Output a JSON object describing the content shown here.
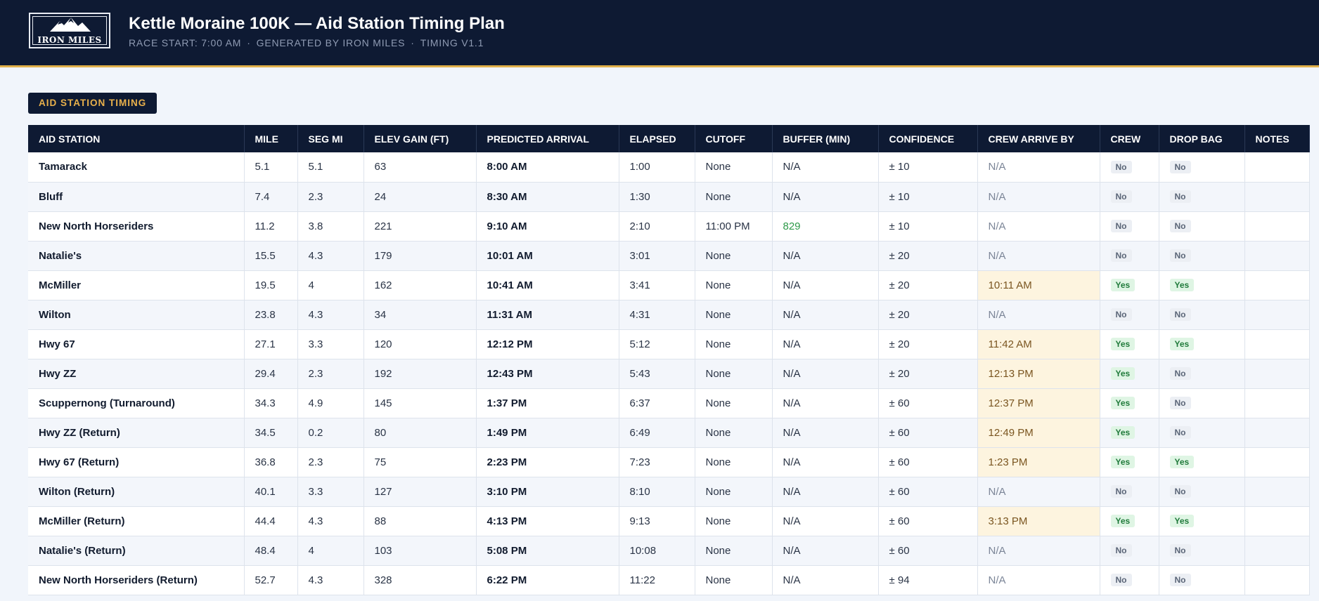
{
  "header": {
    "logo_text": "IRON MILES",
    "title": "Kettle Moraine 100K — Aid Station Timing Plan",
    "subtitle_parts": [
      "RACE START: 7:00 AM",
      "GENERATED BY IRON MILES",
      "TIMING V1.1"
    ],
    "colors": {
      "background": "#0e1a33",
      "accent": "#e0b04a"
    }
  },
  "section_tag": "AID STATION TIMING",
  "table": {
    "columns": [
      "AID STATION",
      "MILE",
      "SEG MI",
      "ELEV GAIN (FT)",
      "PREDICTED ARRIVAL",
      "ELAPSED",
      "CUTOFF",
      "BUFFER (MIN)",
      "CONFIDENCE",
      "CREW ARRIVE BY",
      "CREW",
      "DROP BAG",
      "NOTES"
    ],
    "rows": [
      {
        "station": "Tamarack",
        "mile": "5.1",
        "seg": "5.1",
        "elev": "63",
        "arrival": "8:00 AM",
        "elapsed": "1:00",
        "cutoff": "None",
        "buffer": "N/A",
        "confidence": "± 10",
        "crew_by": "N/A",
        "crew": "No",
        "drop_bag": "No",
        "notes": ""
      },
      {
        "station": "Bluff",
        "mile": "7.4",
        "seg": "2.3",
        "elev": "24",
        "arrival": "8:30 AM",
        "elapsed": "1:30",
        "cutoff": "None",
        "buffer": "N/A",
        "confidence": "± 10",
        "crew_by": "N/A",
        "crew": "No",
        "drop_bag": "No",
        "notes": ""
      },
      {
        "station": "New North Horseriders",
        "mile": "11.2",
        "seg": "3.8",
        "elev": "221",
        "arrival": "9:10 AM",
        "elapsed": "2:10",
        "cutoff": "11:00 PM",
        "buffer": "829",
        "confidence": "± 10",
        "crew_by": "N/A",
        "crew": "No",
        "drop_bag": "No",
        "notes": ""
      },
      {
        "station": "Natalie's",
        "mile": "15.5",
        "seg": "4.3",
        "elev": "179",
        "arrival": "10:01 AM",
        "elapsed": "3:01",
        "cutoff": "None",
        "buffer": "N/A",
        "confidence": "± 20",
        "crew_by": "N/A",
        "crew": "No",
        "drop_bag": "No",
        "notes": ""
      },
      {
        "station": "McMiller",
        "mile": "19.5",
        "seg": "4",
        "elev": "162",
        "arrival": "10:41 AM",
        "elapsed": "3:41",
        "cutoff": "None",
        "buffer": "N/A",
        "confidence": "± 20",
        "crew_by": "10:11 AM",
        "crew": "Yes",
        "drop_bag": "Yes",
        "notes": ""
      },
      {
        "station": "Wilton",
        "mile": "23.8",
        "seg": "4.3",
        "elev": "34",
        "arrival": "11:31 AM",
        "elapsed": "4:31",
        "cutoff": "None",
        "buffer": "N/A",
        "confidence": "± 20",
        "crew_by": "N/A",
        "crew": "No",
        "drop_bag": "No",
        "notes": ""
      },
      {
        "station": "Hwy 67",
        "mile": "27.1",
        "seg": "3.3",
        "elev": "120",
        "arrival": "12:12 PM",
        "elapsed": "5:12",
        "cutoff": "None",
        "buffer": "N/A",
        "confidence": "± 20",
        "crew_by": "11:42 AM",
        "crew": "Yes",
        "drop_bag": "Yes",
        "notes": ""
      },
      {
        "station": "Hwy ZZ",
        "mile": "29.4",
        "seg": "2.3",
        "elev": "192",
        "arrival": "12:43 PM",
        "elapsed": "5:43",
        "cutoff": "None",
        "buffer": "N/A",
        "confidence": "± 20",
        "crew_by": "12:13 PM",
        "crew": "Yes",
        "drop_bag": "No",
        "notes": ""
      },
      {
        "station": "Scuppernong (Turnaround)",
        "mile": "34.3",
        "seg": "4.9",
        "elev": "145",
        "arrival": "1:37 PM",
        "elapsed": "6:37",
        "cutoff": "None",
        "buffer": "N/A",
        "confidence": "± 60",
        "crew_by": "12:37 PM",
        "crew": "Yes",
        "drop_bag": "No",
        "notes": ""
      },
      {
        "station": "Hwy ZZ (Return)",
        "mile": "34.5",
        "seg": "0.2",
        "elev": "80",
        "arrival": "1:49 PM",
        "elapsed": "6:49",
        "cutoff": "None",
        "buffer": "N/A",
        "confidence": "± 60",
        "crew_by": "12:49 PM",
        "crew": "Yes",
        "drop_bag": "No",
        "notes": ""
      },
      {
        "station": "Hwy 67 (Return)",
        "mile": "36.8",
        "seg": "2.3",
        "elev": "75",
        "arrival": "2:23 PM",
        "elapsed": "7:23",
        "cutoff": "None",
        "buffer": "N/A",
        "confidence": "± 60",
        "crew_by": "1:23 PM",
        "crew": "Yes",
        "drop_bag": "Yes",
        "notes": ""
      },
      {
        "station": "Wilton (Return)",
        "mile": "40.1",
        "seg": "3.3",
        "elev": "127",
        "arrival": "3:10 PM",
        "elapsed": "8:10",
        "cutoff": "None",
        "buffer": "N/A",
        "confidence": "± 60",
        "crew_by": "N/A",
        "crew": "No",
        "drop_bag": "No",
        "notes": ""
      },
      {
        "station": "McMiller (Return)",
        "mile": "44.4",
        "seg": "4.3",
        "elev": "88",
        "arrival": "4:13 PM",
        "elapsed": "9:13",
        "cutoff": "None",
        "buffer": "N/A",
        "confidence": "± 60",
        "crew_by": "3:13 PM",
        "crew": "Yes",
        "drop_bag": "Yes",
        "notes": ""
      },
      {
        "station": "Natalie's (Return)",
        "mile": "48.4",
        "seg": "4",
        "elev": "103",
        "arrival": "5:08 PM",
        "elapsed": "10:08",
        "cutoff": "None",
        "buffer": "N/A",
        "confidence": "± 60",
        "crew_by": "N/A",
        "crew": "No",
        "drop_bag": "No",
        "notes": ""
      },
      {
        "station": "New North Horseriders (Return)",
        "mile": "52.7",
        "seg": "4.3",
        "elev": "328",
        "arrival": "6:22 PM",
        "elapsed": "11:22",
        "cutoff": "None",
        "buffer": "N/A",
        "confidence": "± 94",
        "crew_by": "N/A",
        "crew": "No",
        "drop_bag": "No",
        "notes": ""
      }
    ]
  }
}
